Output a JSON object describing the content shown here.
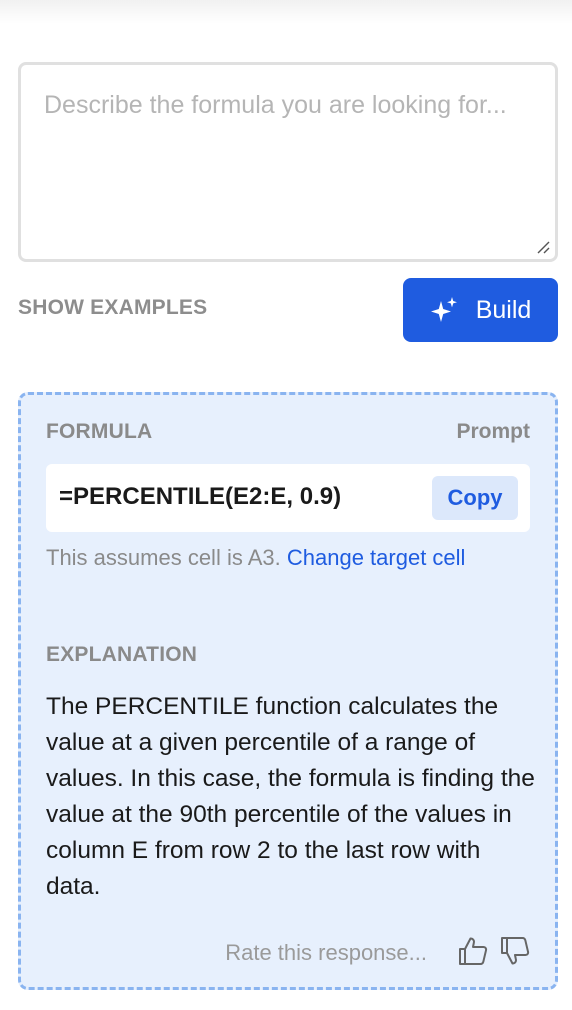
{
  "prompt": {
    "placeholder": "Describe the formula you are looking for..."
  },
  "actions": {
    "show_examples": "SHOW EXAMPLES",
    "build_label": "Build"
  },
  "result": {
    "formula_heading": "FORMULA",
    "prompt_link": "Prompt",
    "formula": "=PERCENTILE(E2:E, 0.9)",
    "copy_label": "Copy",
    "assumes_text": "This assumes cell is A3.",
    "change_target_label": "Change target cell",
    "explanation_heading": "EXPLANATION",
    "explanation": "The PERCENTILE function calculates the value at a given percentile of a range of values. In this case, the formula is finding the value at the 90th percentile of the values in column E from row 2 to the last row with data.",
    "rate_text": "Rate this response..."
  },
  "icons": {
    "build": "sparkle-icon",
    "rate_up": "thumbs-up-icon",
    "rate_down": "thumbs-down-icon",
    "resize": "resize-grip-icon"
  },
  "colors": {
    "accent": "#1f5ce0",
    "card_background": "#e7f0fd",
    "card_border": "#8ab4f0"
  }
}
